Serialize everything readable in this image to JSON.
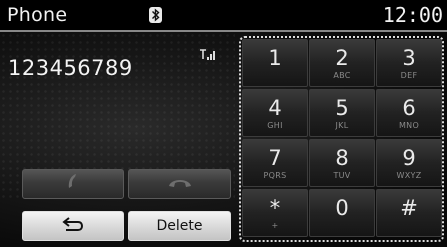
{
  "header": {
    "title": "Phone",
    "clock": "12:00"
  },
  "dialer": {
    "number": "123456789"
  },
  "actions": {
    "delete_label": "Delete"
  },
  "keypad": [
    {
      "digit": "1",
      "letters": ""
    },
    {
      "digit": "2",
      "letters": "ABC"
    },
    {
      "digit": "3",
      "letters": "DEF"
    },
    {
      "digit": "4",
      "letters": "GHI"
    },
    {
      "digit": "5",
      "letters": "JKL"
    },
    {
      "digit": "6",
      "letters": "MNO"
    },
    {
      "digit": "7",
      "letters": "PQRS"
    },
    {
      "digit": "8",
      "letters": "TUV"
    },
    {
      "digit": "9",
      "letters": "WXYZ"
    },
    {
      "digit": "*",
      "letters": "+"
    },
    {
      "digit": "0",
      "letters": ""
    },
    {
      "digit": "#",
      "letters": ""
    }
  ],
  "icons": {
    "status": [
      "bluetooth-icon",
      "signal-strength-icon"
    ],
    "buttons": [
      "call-icon",
      "end-call-icon",
      "back-arrow-icon"
    ]
  },
  "colors": {
    "background": "#000000",
    "button_light": "#e0e0e0",
    "key_dark": "#222222"
  }
}
